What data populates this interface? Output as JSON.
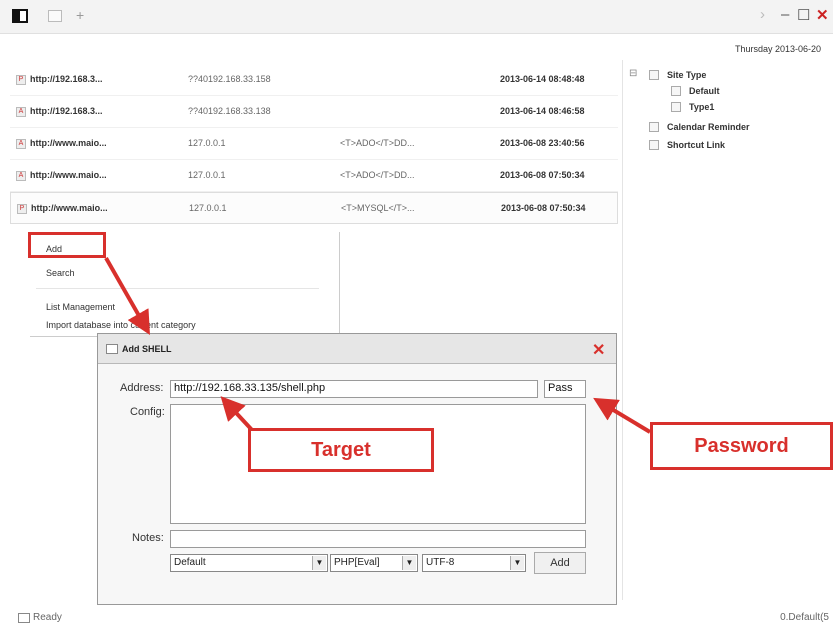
{
  "toolbar": {
    "new_tab": "+",
    "nav_forward": "›",
    "minimize": "–",
    "maximize": "☐",
    "close": "✕"
  },
  "date": "Thursday 2013-06-20",
  "sites": [
    {
      "url": "http://192.168.3...",
      "ip": "??40192.168.33.158",
      "note": "",
      "time": "2013-06-14 08:48:48"
    },
    {
      "url": "http://192.168.3...",
      "ip": "??40192.168.33.138",
      "note": "",
      "time": "2013-06-14 08:46:58"
    },
    {
      "url": "http://www.maio...",
      "ip": "127.0.0.1",
      "note": "<T>ADO</T>DD...",
      "time": "2013-06-08 23:40:56"
    },
    {
      "url": "http://www.maio...",
      "ip": "127.0.0.1",
      "note": "<T>ADO</T>DD...",
      "time": "2013-06-08 07:50:34"
    },
    {
      "url": "http://www.maio...",
      "ip": "127.0.0.1",
      "note": "<T>MYSQL</T>...",
      "time": "2013-06-08 07:50:34"
    }
  ],
  "tree": {
    "site_type": "Site Type",
    "default": "Default",
    "type1": "Type1",
    "calendar": "Calendar Reminder",
    "shortcut": "Shortcut Link"
  },
  "context_menu": {
    "add": "Add",
    "search": "Search",
    "list_management": "List Management",
    "import": "Import database into current category"
  },
  "dialog": {
    "title": "Add SHELL",
    "close": "✕",
    "address_label": "Address:",
    "address_value": "http://192.168.33.135/shell.php",
    "pass_value": "Pass",
    "config_label": "Config:",
    "notes_label": "Notes:",
    "type_select": "Default",
    "script_select": "PHP[Eval]",
    "encoding_select": "UTF-8",
    "add_button": "Add"
  },
  "callouts": {
    "target": "Target",
    "password": "Password"
  },
  "status": {
    "ready": "Ready",
    "right": "0.Default(5"
  },
  "colors": {
    "annotation_red": "#d8302c"
  }
}
